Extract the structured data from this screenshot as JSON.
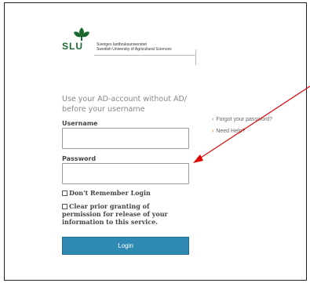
{
  "logo": {
    "wordmark": "SLU",
    "institution_line1": "Sveriges lantbruksuniversitet",
    "institution_line2": "Swedish University of Agricultural Sciences",
    "accent_color": "#1a6a30"
  },
  "login": {
    "hint": "Use your AD-account without AD/ before your username",
    "username_label": "Username",
    "username_value": "",
    "password_label": "Password",
    "password_value": "",
    "dont_remember_label": "Don't Remember Login",
    "clear_consent_label": "Clear prior granting of permission for release of your information to this service.",
    "login_button": "Login",
    "button_color": "#2f8ab3"
  },
  "side_links": {
    "forgot_password": "Forgot your password?",
    "need_help": "Need Help?",
    "chevron_icon": "chevron-right-icon"
  },
  "annotation": {
    "arrow_color": "#e00000",
    "icon": "red-arrow-icon"
  }
}
